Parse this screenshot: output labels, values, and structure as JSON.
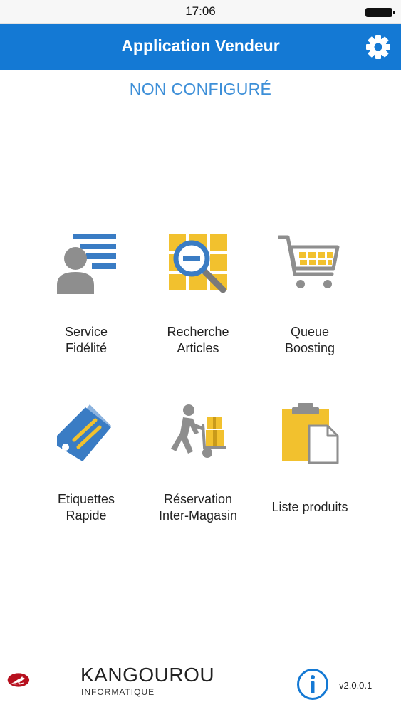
{
  "status_bar": {
    "time": "17:06"
  },
  "navbar": {
    "title": "Application Vendeur"
  },
  "config_status": "NON CONFIGURÉ",
  "tiles": [
    {
      "line1": "Service",
      "line2": "Fidélité",
      "icon": "customer-card-icon"
    },
    {
      "line1": "Recherche",
      "line2": "Articles",
      "icon": "search-articles-icon"
    },
    {
      "line1": "Queue",
      "line2": "Boosting",
      "icon": "shopping-cart-icon"
    },
    {
      "line1": "Etiquettes",
      "line2": "Rapide",
      "icon": "price-tags-icon"
    },
    {
      "line1": "Réservation",
      "line2": "Inter-Magasin",
      "icon": "delivery-person-icon"
    },
    {
      "line1": "Liste produits",
      "icon": "clipboard-list-icon"
    }
  ],
  "footer": {
    "brand": "KANGOUROU",
    "brand_sub": "INFORMATIQUE",
    "version": "v2.0.0.1"
  },
  "colors": {
    "navbar": "#1479d4",
    "accent_text": "#3d8fd8",
    "icon_blue": "#3a7cc4",
    "icon_yellow": "#f2c12e",
    "icon_gray": "#8e8e8e",
    "logo_red": "#b7101e"
  }
}
